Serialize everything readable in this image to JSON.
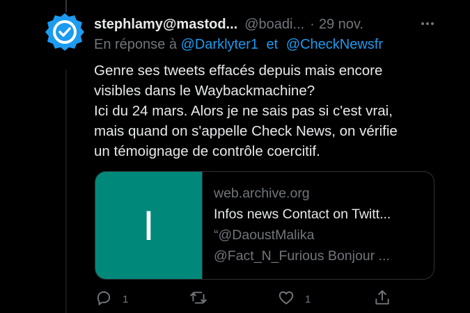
{
  "tweet": {
    "display_name": "stephlamy@mastod...",
    "handle": "@boadi...",
    "separator": "·",
    "date": "29 nov.",
    "verified": true,
    "reply_prefix": "En réponse à",
    "reply_mentions": [
      "@Darklyter1",
      "@CheckNewsfr"
    ],
    "reply_joiner": "et",
    "text_lines": [
      "Genre ses tweets effacés depuis mais encore",
      "visibles dans le Waybackmachine?",
      "Ici du 24 mars. Alors je ne sais pas si c'est vrai,",
      "mais quand on s'appelle Check News, on vérifie",
      "un témoignage de contrôle coercitif."
    ]
  },
  "card": {
    "thumb_letter": "I",
    "thumb_color": "#00897b",
    "domain": "web.archive.org",
    "title": "Infos news Contact on Twitt...",
    "desc_lines": [
      "“@DaoustMalika",
      "@Fact_N_Furious Bonjour ..."
    ]
  },
  "actions": {
    "reply_count": "1",
    "retweet_count": "",
    "like_count": "1"
  },
  "icons": {
    "verified": "verified-badge-icon",
    "more": "more-dots-icon",
    "reply": "reply-bubble-icon",
    "retweet": "retweet-icon",
    "like": "heart-icon",
    "share": "share-upload-icon"
  },
  "colors": {
    "background": "#000000",
    "accent": "#1d9bf0",
    "text": "#e7e9ea",
    "muted": "#71767b",
    "border": "#2f3336"
  }
}
